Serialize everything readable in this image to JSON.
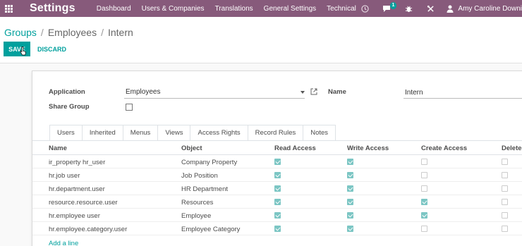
{
  "navbar": {
    "app_title": "Settings",
    "menu": [
      "Dashboard",
      "Users & Companies",
      "Translations",
      "General Settings",
      "Technical"
    ],
    "message_count": "1",
    "user_name": "Amy Caroline Downi"
  },
  "breadcrumb": {
    "parent": "Groups",
    "parent2": "Employees",
    "current": "Intern",
    "separator": "/"
  },
  "actions": {
    "save": "SAVE",
    "discard": "DISCARD"
  },
  "form": {
    "application_label": "Application",
    "application_value": "Employees",
    "name_label": "Name",
    "name_value": "Intern",
    "share_group_label": "Share Group",
    "share_group_checked": false
  },
  "tabs": [
    "Users",
    "Inherited",
    "Menus",
    "Views",
    "Access Rights",
    "Record Rules",
    "Notes"
  ],
  "active_tab": "Access Rights",
  "table": {
    "headers": [
      "Name",
      "Object",
      "Read Access",
      "Write Access",
      "Create Access",
      "Delete"
    ],
    "rows": [
      {
        "name": "ir_property hr_user",
        "object": "Company Property",
        "read": true,
        "write": true,
        "create": false,
        "delete": false
      },
      {
        "name": "hr.job user",
        "object": "Job Position",
        "read": true,
        "write": true,
        "create": false,
        "delete": false
      },
      {
        "name": "hr.department.user",
        "object": "HR Department",
        "read": true,
        "write": true,
        "create": false,
        "delete": false
      },
      {
        "name": "resource.resource.user",
        "object": "Resources",
        "read": true,
        "write": true,
        "create": true,
        "delete": false
      },
      {
        "name": "hr.employee user",
        "object": "Employee",
        "read": true,
        "write": true,
        "create": true,
        "delete": false
      },
      {
        "name": "hr.employee.category.user",
        "object": "Employee Category",
        "read": true,
        "write": true,
        "create": false,
        "delete": false
      }
    ],
    "add_line": "Add a line"
  },
  "colors": {
    "navbar": "#875a7b",
    "primary": "#00a09d",
    "checkbox_checked": "#7cc6c4"
  }
}
